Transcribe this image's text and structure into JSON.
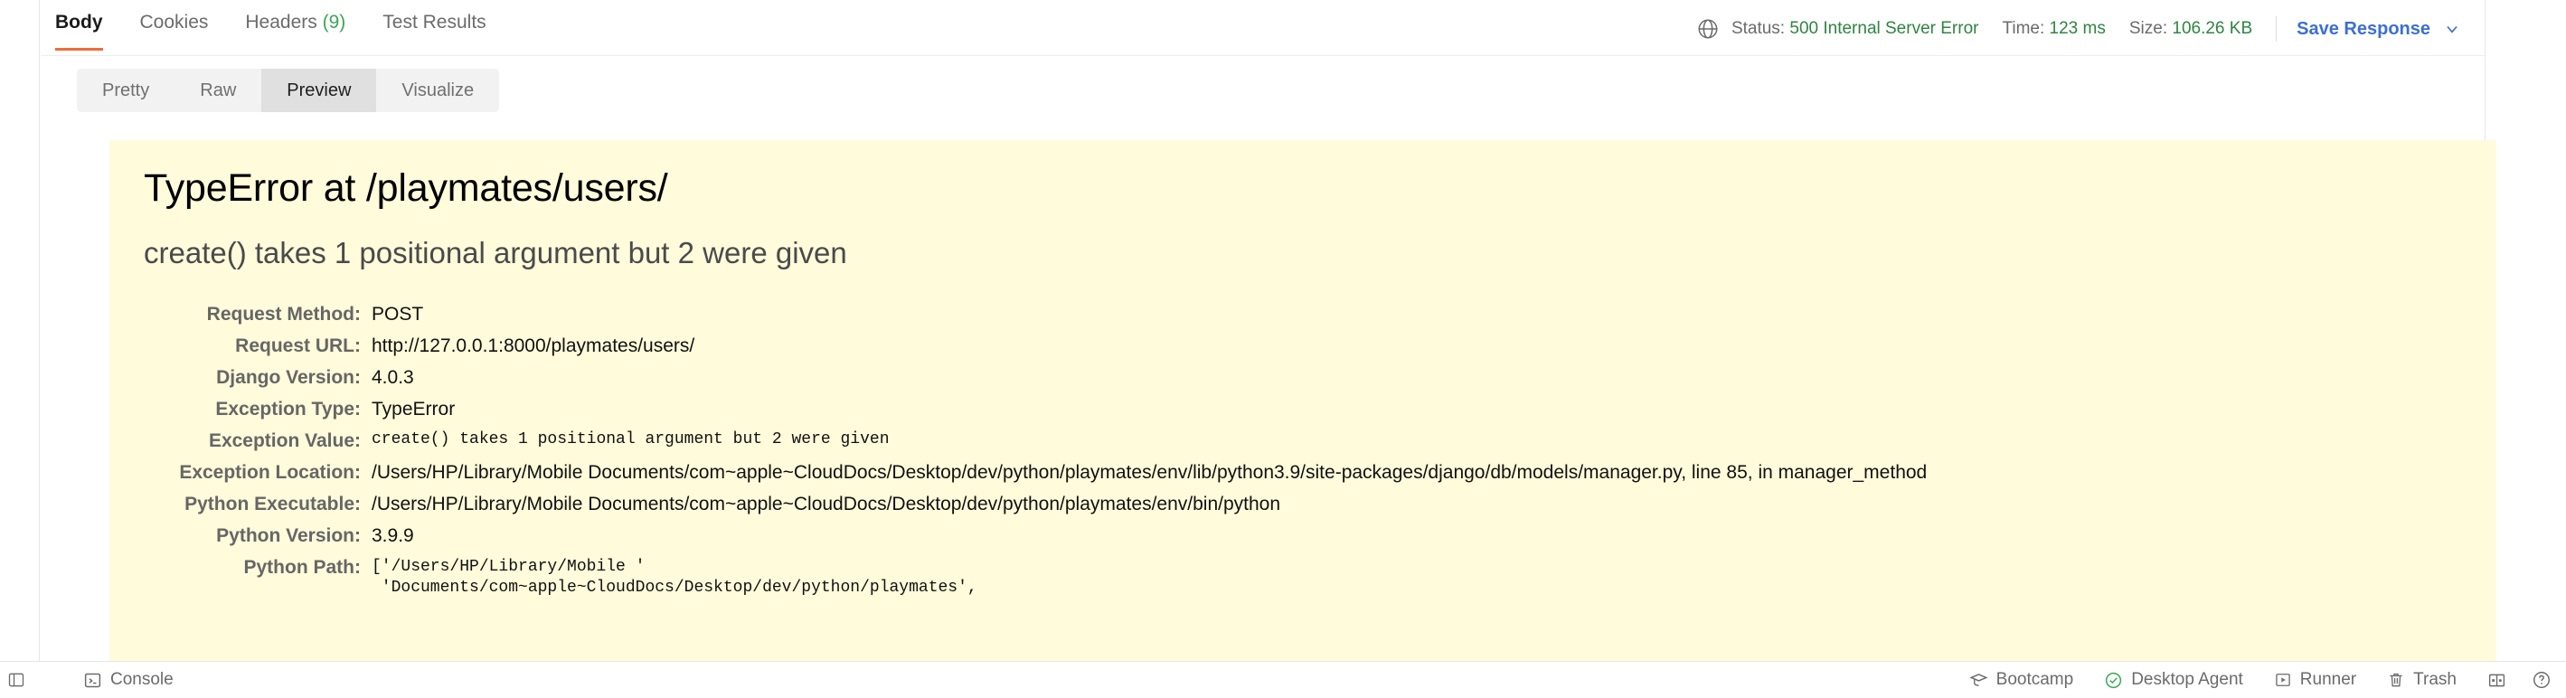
{
  "response": {
    "tabs": [
      {
        "label": "Body",
        "count": null,
        "active": true
      },
      {
        "label": "Cookies",
        "count": null,
        "active": false
      },
      {
        "label": "Headers",
        "count": "(9)",
        "active": false
      },
      {
        "label": "Test Results",
        "count": null,
        "active": false
      }
    ],
    "meta": {
      "globe_icon": "globe-icon",
      "status_label": "Status:",
      "status_value": "500 Internal Server Error",
      "time_label": "Time:",
      "time_value": "123 ms",
      "size_label": "Size:",
      "size_value": "106.26 KB",
      "save_response_label": "Save Response",
      "chevron_icon": "chevron-down-icon"
    },
    "view_modes": [
      {
        "label": "Pretty",
        "active": false
      },
      {
        "label": "Raw",
        "active": false
      },
      {
        "label": "Preview",
        "active": true
      },
      {
        "label": "Visualize",
        "active": false
      }
    ]
  },
  "preview": {
    "title": "TypeError at /playmates/users/",
    "subtitle": "create() takes 1 positional argument but 2 were given",
    "rows": [
      {
        "label": "Request Method:",
        "value": "POST",
        "mono": false
      },
      {
        "label": "Request URL:",
        "value": "http://127.0.0.1:8000/playmates/users/",
        "mono": false
      },
      {
        "label": "Django Version:",
        "value": "4.0.3",
        "mono": false
      },
      {
        "label": "Exception Type:",
        "value": "TypeError",
        "mono": false
      },
      {
        "label": "Exception Value:",
        "value": "create() takes 1 positional argument but 2 were given",
        "mono": true
      },
      {
        "label": "Exception Location:",
        "value": "/Users/HP/Library/Mobile Documents/com~apple~CloudDocs/Desktop/dev/python/playmates/env/lib/python3.9/site-packages/django/db/models/manager.py, line 85, in manager_method",
        "mono": false
      },
      {
        "label": "Python Executable:",
        "value": "/Users/HP/Library/Mobile Documents/com~apple~CloudDocs/Desktop/dev/python/playmates/env/bin/python",
        "mono": false
      },
      {
        "label": "Python Version:",
        "value": "3.9.9",
        "mono": false
      },
      {
        "label": "Python Path:",
        "value": "['/Users/HP/Library/Mobile '\n 'Documents/com~apple~CloudDocs/Desktop/dev/python/playmates',",
        "mono": true
      }
    ]
  },
  "statusbar": {
    "left": [
      {
        "label": "",
        "icon": "panel-left-icon"
      },
      {
        "label": "Console",
        "icon": "console-icon"
      }
    ],
    "right": [
      {
        "label": "Bootcamp",
        "icon": "graduation-cap-icon"
      },
      {
        "label": "Desktop Agent",
        "icon": "check-circle-icon"
      },
      {
        "label": "Runner",
        "icon": "play-box-icon"
      },
      {
        "label": "Trash",
        "icon": "trash-icon"
      },
      {
        "label": "",
        "icon": "layout-split-icon"
      },
      {
        "label": "",
        "icon": "help-circle-icon"
      }
    ]
  },
  "colors": {
    "accent_orange": "#ef6c37",
    "status_green": "#2e8540",
    "link_blue": "#3b6fd4",
    "django_bg": "#fffbdb",
    "agent_green": "#3aa757"
  }
}
